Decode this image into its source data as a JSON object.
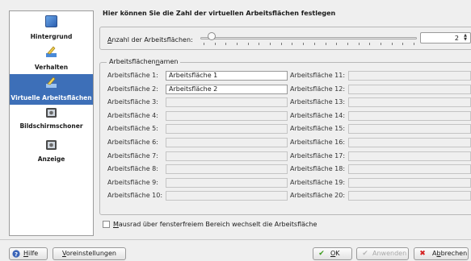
{
  "sidebar": {
    "items": [
      {
        "label": "Hintergrund",
        "icon": "desktop-background-icon"
      },
      {
        "label": "Verhalten",
        "icon": "behavior-tools-icon"
      },
      {
        "label": "Virtuelle Arbeitsflächen",
        "icon": "virtual-desktops-icon",
        "active": true
      },
      {
        "label": "Bildschirmschoner",
        "icon": "screensaver-monitor-icon"
      },
      {
        "label": "Anzeige",
        "icon": "display-monitor-icon"
      }
    ]
  },
  "main": {
    "heading": "Hier können Sie die Zahl der virtuellen Arbeitsflächen festlegen",
    "count": {
      "label_pre": "A",
      "label_rest": "nzahl der Arbeitsflächen:",
      "value": "2",
      "slider_min": 1,
      "slider_max": 20
    },
    "names_group": {
      "title_pre": "Arbeitsflächen",
      "title_ul": "n",
      "title_post": "amen"
    },
    "workspaces": [
      {
        "label": "Arbeitsfläche 1:",
        "value": "Arbeitsfläche 1"
      },
      {
        "label": "Arbeitsfläche 2:",
        "value": "Arbeitsfläche 2"
      },
      {
        "label": "Arbeitsfläche 3:",
        "value": ""
      },
      {
        "label": "Arbeitsfläche 4:",
        "value": ""
      },
      {
        "label": "Arbeitsfläche 5:",
        "value": ""
      },
      {
        "label": "Arbeitsfläche 6:",
        "value": ""
      },
      {
        "label": "Arbeitsfläche 7:",
        "value": ""
      },
      {
        "label": "Arbeitsfläche 8:",
        "value": ""
      },
      {
        "label": "Arbeitsfläche 9:",
        "value": ""
      },
      {
        "label": "Arbeitsfläche 10:",
        "value": ""
      },
      {
        "label": "Arbeitsfläche 11:",
        "value": ""
      },
      {
        "label": "Arbeitsfläche 12:",
        "value": ""
      },
      {
        "label": "Arbeitsfläche 13:",
        "value": ""
      },
      {
        "label": "Arbeitsfläche 14:",
        "value": ""
      },
      {
        "label": "Arbeitsfläche 15:",
        "value": ""
      },
      {
        "label": "Arbeitsfläche 16:",
        "value": ""
      },
      {
        "label": "Arbeitsfläche 17:",
        "value": ""
      },
      {
        "label": "Arbeitsfläche 18:",
        "value": ""
      },
      {
        "label": "Arbeitsfläche 19:",
        "value": ""
      },
      {
        "label": "Arbeitsfläche 20:",
        "value": ""
      }
    ],
    "mousewheel": {
      "pre": "M",
      "rest": "ausrad über fensterfreiem Bereich wechselt die Arbeitsfläche"
    }
  },
  "footer": {
    "help": {
      "pre": "H",
      "rest": "ilfe"
    },
    "defaults": {
      "pre": "V",
      "rest": "oreinstellungen"
    },
    "ok": {
      "pre": "O",
      "rest": "K"
    },
    "apply": {
      "label": "Anwenden"
    },
    "cancel": {
      "pre": "A",
      "ul": "b",
      "rest": "brechen"
    }
  },
  "colors": {
    "selection": "#3d6fb8",
    "ok_check": "#3a9a1a",
    "cancel_x": "#d42020",
    "help_icon": "#3a64b8"
  }
}
